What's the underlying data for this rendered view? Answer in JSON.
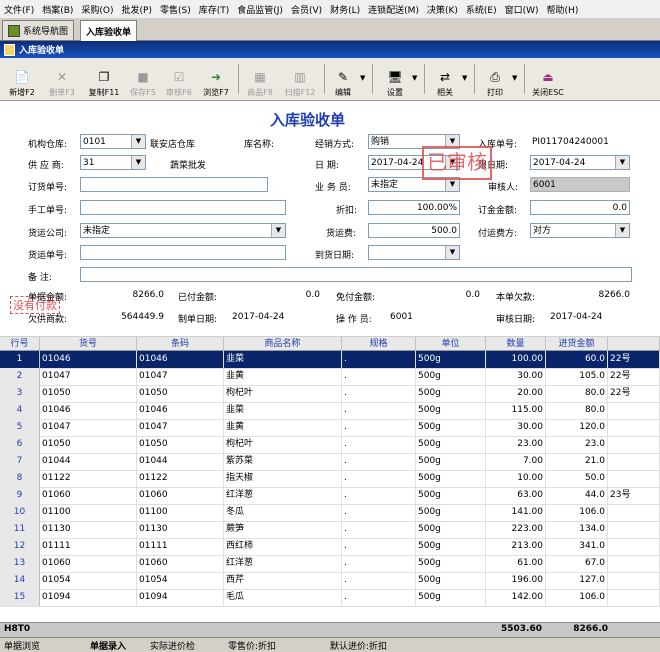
{
  "menu": [
    "文件(F)",
    "档案(B)",
    "采购(O)",
    "批发(P)",
    "零售(S)",
    "库存(T)",
    "食品监管(J)",
    "会员(V)",
    "财务(L)",
    "连锁配送(M)",
    "决策(K)",
    "系统(E)",
    "窗口(W)",
    "帮助(H)"
  ],
  "tabs": {
    "nav": "系统导航图",
    "active": "入库验收单"
  },
  "window_title": "入库验收单",
  "toolbar": {
    "new": "新增F2",
    "delete": "删单F3",
    "copy": "复制F11",
    "save": "保存F5",
    "audit": "审核F6",
    "browse": "浏览F7",
    "goods": "商品F8",
    "scan": "扫描F12",
    "edit": "编辑",
    "settings": "设置",
    "related": "相关",
    "print": "打印",
    "close": "关闭ESC"
  },
  "form": {
    "title": "入库验收单",
    "warehouse_label": "机构仓库:",
    "warehouse_code": "0101",
    "warehouse_name": "联安店仓库",
    "supplier_label": "供 应 商:",
    "supplier_code": "31",
    "supplier_name": "蔬菜批发",
    "order_label": "订货单号:",
    "order_value": "",
    "manual_label": "手工单号:",
    "manual_value": "",
    "freight_co_label": "货运公司:",
    "freight_co_value": "未指定",
    "freight_no_label": "货运单号:",
    "freight_no_value": "",
    "remark_label": "备    注:",
    "remark_value": "",
    "warehouse_name_label": "库名称:",
    "mode_label": "经销方式:",
    "mode_value": "购销",
    "date_label": "日    期:",
    "date_value": "2017-04-24",
    "staff_label": "业 务 员:",
    "staff_value": "未指定",
    "discount_label": "折扣:",
    "discount_value": "100.00%",
    "freight_label": "货运费:",
    "freight_value": "500.0",
    "arrive_label": "到货日期:",
    "arrive_value": "",
    "bill_no_label": "入库单号:",
    "bill_no_value": "PI011704240001",
    "deadline_label": "限日期:",
    "deadline_value": "2017-04-24",
    "auditor_label": "审核人:",
    "auditor_value": "6001",
    "deposit_label": "订金金额:",
    "deposit_value": "0.0",
    "payer_label": "付运费方:",
    "payer_value": "对方",
    "stamp": "已审核",
    "unpaid_stamp": "没有付款",
    "bill_amount_label": "单据金额:",
    "bill_amount_value": "8266.0",
    "paid_label": "已付金额:",
    "paid_value": "0.0",
    "free_label": "免付金额:",
    "free_value": "0.0",
    "owed_label": "本单欠款:",
    "owed_value": "8266.0",
    "supplier_owed_label": "欠供商款:",
    "supplier_owed_value": "564449.9",
    "make_date_label": "制单日期:",
    "make_date_value": "2017-04-24",
    "operator_label": "操 作 员:",
    "operator_value": "6001",
    "audit_date_label": "审核日期:",
    "audit_date_value": "2017-04-24"
  },
  "grid": {
    "headers": [
      "行号",
      "货号",
      "条码",
      "商品名称",
      "规格",
      "单位",
      "数量",
      "进货金额",
      ""
    ],
    "rows": [
      [
        "1",
        "01046",
        "01046",
        "韭菜",
        ".",
        "500g",
        "100.00",
        "60.0",
        "22号"
      ],
      [
        "2",
        "01047",
        "01047",
        "韭黄",
        ".",
        "500g",
        "30.00",
        "105.0",
        "22号"
      ],
      [
        "3",
        "01050",
        "01050",
        "枸杞叶",
        ".",
        "500g",
        "20.00",
        "80.0",
        "22号"
      ],
      [
        "4",
        "01046",
        "01046",
        "韭菜",
        ".",
        "500g",
        "115.00",
        "80.0",
        ""
      ],
      [
        "5",
        "01047",
        "01047",
        "韭黄",
        ".",
        "500g",
        "30.00",
        "120.0",
        ""
      ],
      [
        "6",
        "01050",
        "01050",
        "枸杞叶",
        ".",
        "500g",
        "23.00",
        "23.0",
        ""
      ],
      [
        "7",
        "01044",
        "01044",
        "紫苏菜",
        ".",
        "500g",
        "7.00",
        "21.0",
        ""
      ],
      [
        "8",
        "01122",
        "01122",
        "指天椒",
        ".",
        "500g",
        "10.00",
        "50.0",
        ""
      ],
      [
        "9",
        "01060",
        "01060",
        "红洋葱",
        ".",
        "500g",
        "63.00",
        "44.0",
        "23号"
      ],
      [
        "10",
        "01100",
        "01100",
        "冬瓜",
        ".",
        "500g",
        "141.00",
        "106.0",
        ""
      ],
      [
        "11",
        "01130",
        "01130",
        "蕨笋",
        ".",
        "500g",
        "223.00",
        "134.0",
        ""
      ],
      [
        "12",
        "01111",
        "01111",
        "西红柿",
        ".",
        "500g",
        "213.00",
        "341.0",
        ""
      ],
      [
        "13",
        "01060",
        "01060",
        "红洋葱",
        ".",
        "500g",
        "61.00",
        "67.0",
        ""
      ],
      [
        "14",
        "01054",
        "01054",
        "西芹",
        ".",
        "500g",
        "196.00",
        "127.0",
        ""
      ],
      [
        "15",
        "01094",
        "01094",
        "毛瓜",
        ".",
        "500g",
        "142.00",
        "106.0",
        ""
      ]
    ],
    "footer_label": "H8T0",
    "total_qty": "5503.60",
    "total_amount": "8266.0"
  },
  "bottom_tabs": [
    "单据浏览",
    "单据录入",
    "实际进价检",
    "零售价:折扣",
    "默认进价:折扣"
  ],
  "colors": {
    "title_bar": "#0c2d7a",
    "selected_row": "#0a246a",
    "header_text": "#1f3fb0",
    "stamp": "#e05050"
  }
}
